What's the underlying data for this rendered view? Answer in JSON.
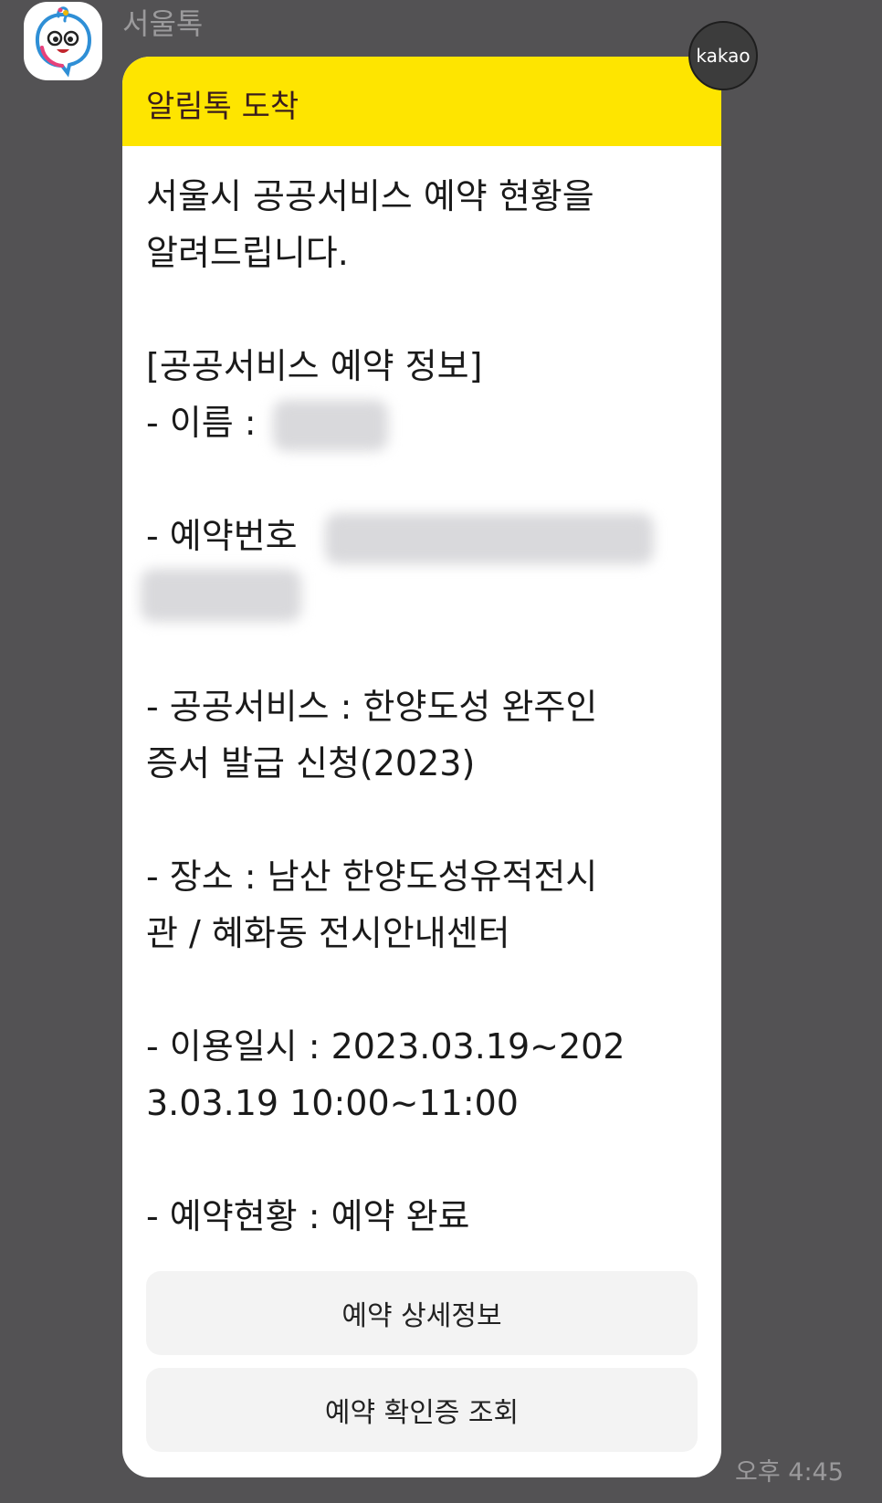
{
  "sender": {
    "name": "서울톡",
    "avatar_icon": "seoul-mascot-icon"
  },
  "badge": {
    "label": "kakao"
  },
  "message": {
    "header_title": "알림톡 도착",
    "intro_line1": "서울시 공공서비스 예약 현황을",
    "intro_line2": "알려드립니다.",
    "section_title": "[공공서비스 예약 정보]",
    "name_label": "- 이름 : ",
    "reservation_no_label": "- 예약번호 ",
    "service_line1": "- 공공서비스 : 한양도성 완주인",
    "service_line2": "증서 발급 신청(2023)",
    "place_line1": "- 장소 : 남산 한양도성유적전시",
    "place_line2": "관 / 혜화동 전시안내센터",
    "datetime_line1": "- 이용일시 : 2023.03.19~202",
    "datetime_line2": "3.03.19 10:00~11:00",
    "status_line": "- 예약현황 : 예약 완료"
  },
  "buttons": {
    "detail_label": "예약 상세정보",
    "confirm_label": "예약 확인증 조회"
  },
  "timestamp": "오후 4:45",
  "colors": {
    "background": "#535254",
    "header_yellow": "#fee500",
    "bubble": "#ffffff",
    "button_bg": "#f3f3f3"
  }
}
